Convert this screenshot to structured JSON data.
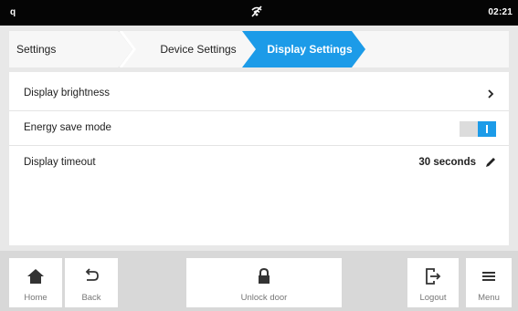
{
  "statusbar": {
    "left_indicator": "q",
    "center_icon": "wifi-off-icon",
    "time": "02:21"
  },
  "breadcrumb": {
    "items": [
      {
        "label": "Settings"
      },
      {
        "label": "Device Settings"
      },
      {
        "label": "Display Settings"
      }
    ],
    "active_color": "#1c9be8"
  },
  "settings": {
    "brightness": {
      "label": "Display brightness"
    },
    "energy_save": {
      "label": "Energy save mode",
      "on": true
    },
    "timeout": {
      "label": "Display timeout",
      "value": "30 seconds"
    }
  },
  "bottombar": {
    "home": "Home",
    "back": "Back",
    "unlock": "Unlock door",
    "logout": "Logout",
    "menu": "Menu"
  }
}
